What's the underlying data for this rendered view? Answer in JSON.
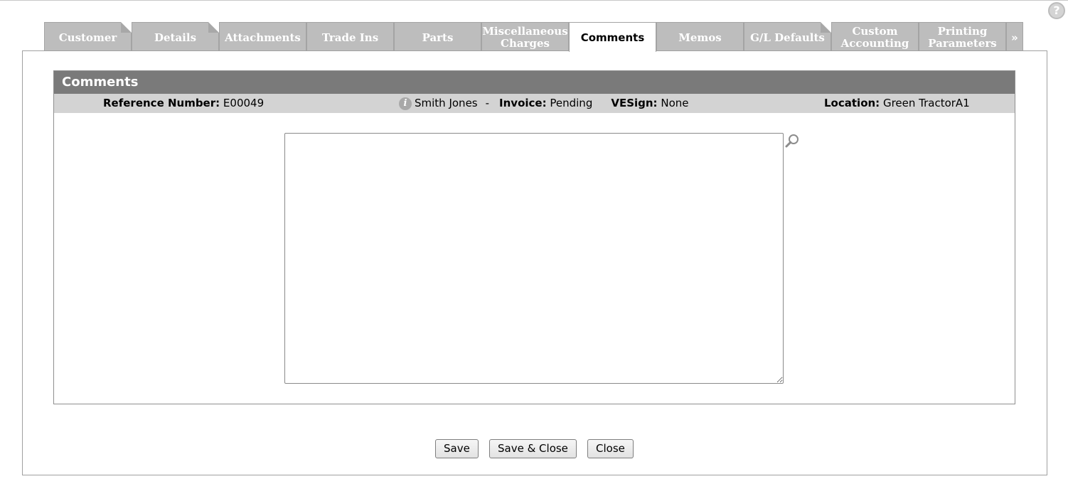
{
  "help": {
    "icon": "question-circle-icon",
    "glyph": "?"
  },
  "tabs": [
    {
      "label": "Customer",
      "fold": true
    },
    {
      "label": "Details",
      "fold": true
    },
    {
      "label": "Attachments",
      "fold": false
    },
    {
      "label": "Trade Ins",
      "fold": false
    },
    {
      "label": "Parts",
      "fold": false
    },
    {
      "label": "Miscellaneous\nCharges",
      "fold": false
    },
    {
      "label": "Comments",
      "fold": false,
      "active": true
    },
    {
      "label": "Memos",
      "fold": false
    },
    {
      "label": "G/L Defaults",
      "fold": true
    },
    {
      "label": "Custom\nAccounting",
      "fold": false
    },
    {
      "label": "Printing\nParameters",
      "fold": false
    },
    {
      "label": "»",
      "fold": false,
      "more": true
    }
  ],
  "section": {
    "title": "Comments",
    "reference_label": "Reference Number:",
    "reference_value": "E00049",
    "customer_name": "Smith Jones",
    "separator": "-",
    "invoice_label": "Invoice:",
    "invoice_value": "Pending",
    "vesign_label": "VESign:",
    "vesign_value": "None",
    "location_label": "Location:",
    "location_value": "Green TractorA1"
  },
  "comments": {
    "value": "",
    "placeholder": ""
  },
  "buttons": {
    "save": "Save",
    "save_close": "Save & Close",
    "close": "Close"
  },
  "colors": {
    "tab_inactive": "#bdbdbd",
    "section_header": "#7a7a7a",
    "info_bar": "#d3d3d3"
  }
}
